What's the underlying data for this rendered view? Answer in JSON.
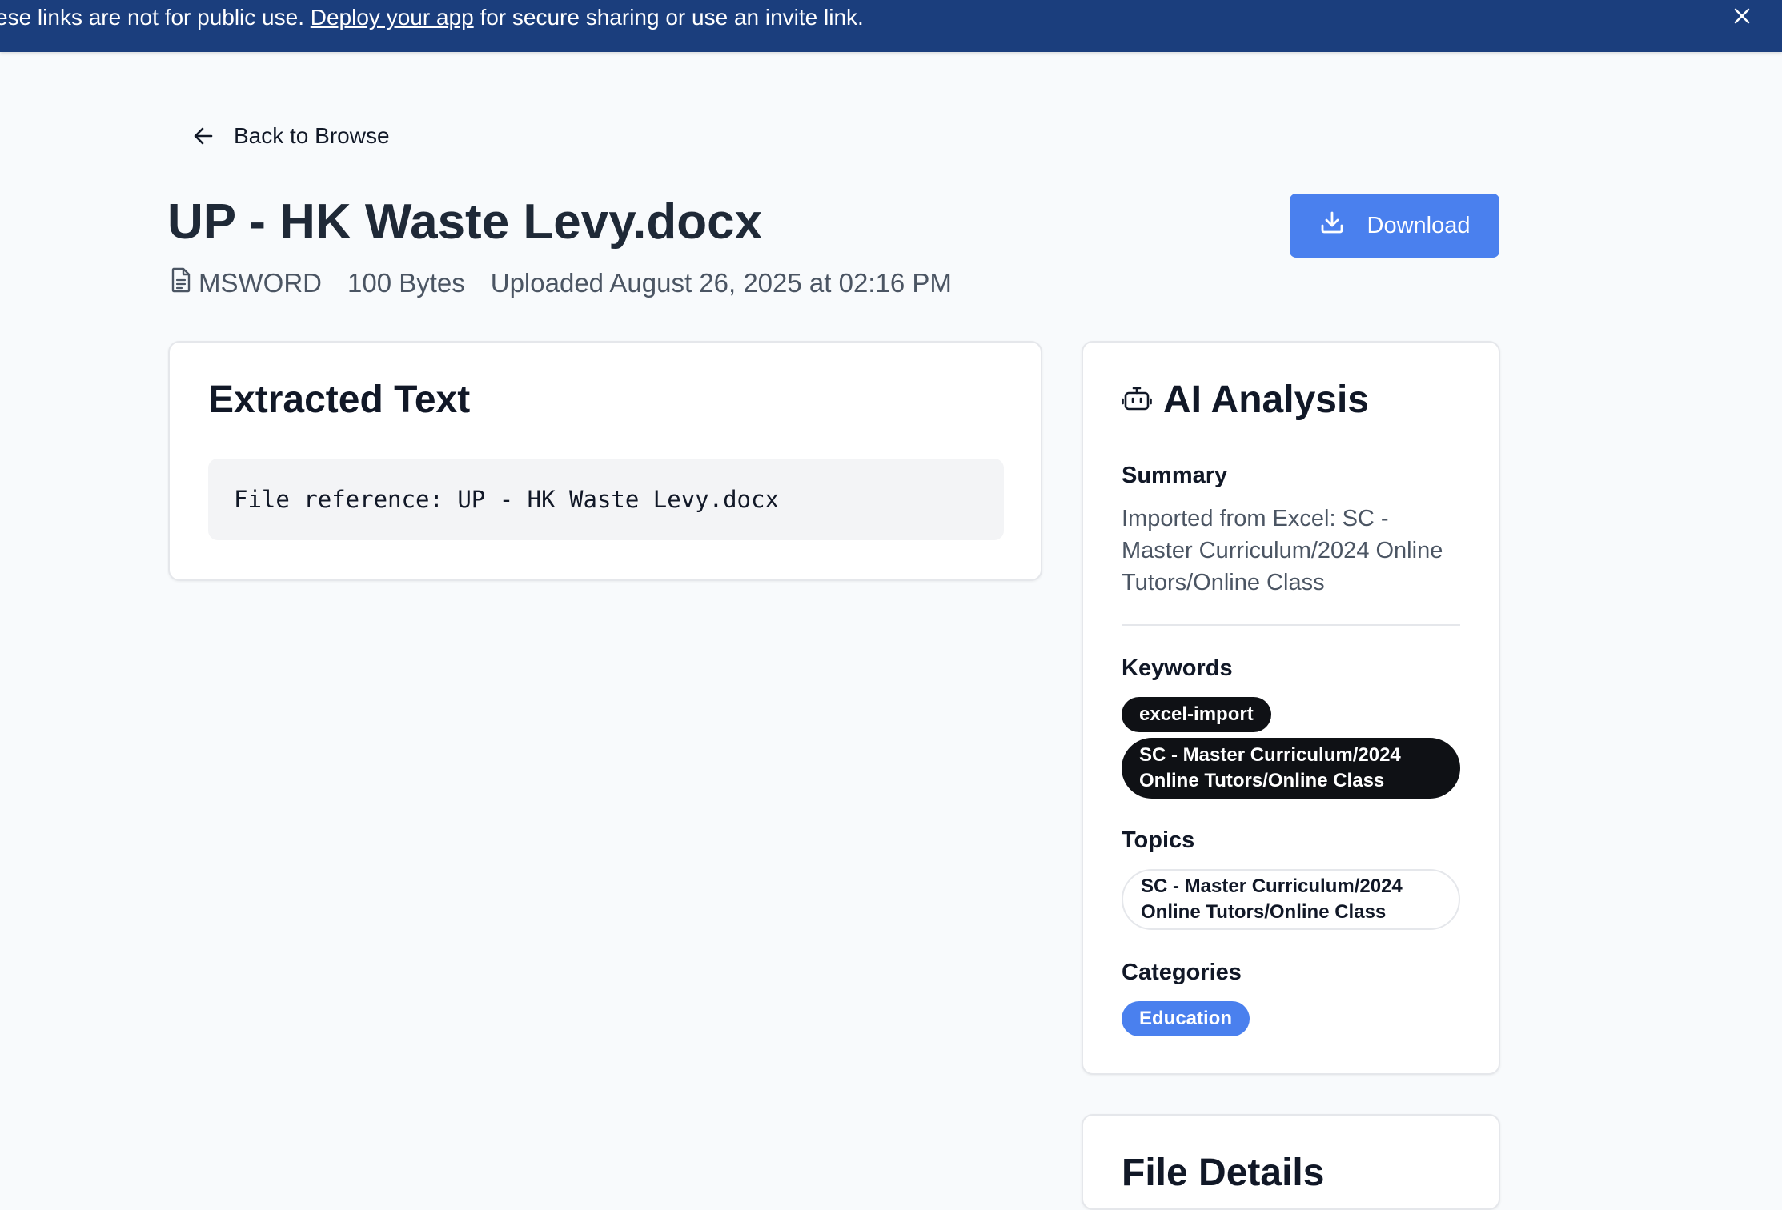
{
  "banner": {
    "text_before": "ese links are not for public use. ",
    "link": "Deploy your app",
    "text_after": " for secure sharing or use an invite link."
  },
  "nav": {
    "back_label": "Back to Browse"
  },
  "document": {
    "title": "UP - HK Waste Levy.docx",
    "type": "MSWORD",
    "size": "100 Bytes",
    "uploaded": "Uploaded August 26, 2025 at 02:16 PM"
  },
  "actions": {
    "download_label": "Download"
  },
  "extracted": {
    "heading": "Extracted Text",
    "content": "File reference: UP - HK Waste Levy.docx"
  },
  "ai": {
    "heading": "AI Analysis",
    "summary_label": "Summary",
    "summary": "Imported from Excel: SC - Master Curriculum/2024 Online Tutors/Online Class",
    "keywords_label": "Keywords",
    "keywords": [
      "excel-import",
      "SC - Master Curriculum/2024 Online Tutors/Online Class"
    ],
    "topics_label": "Topics",
    "topics": [
      "SC - Master Curriculum/2024 Online Tutors/Online Class"
    ],
    "categories_label": "Categories",
    "categories": [
      "Education"
    ]
  },
  "file_details": {
    "heading": "File Details"
  },
  "colors": {
    "banner": "#1b3e7d",
    "accent": "#4a80ee",
    "pill_dark": "#0f1115",
    "page_bg": "#f8fafc"
  },
  "icons": [
    "close-icon",
    "arrow-left-icon",
    "document-icon",
    "download-icon",
    "robot-icon"
  ]
}
